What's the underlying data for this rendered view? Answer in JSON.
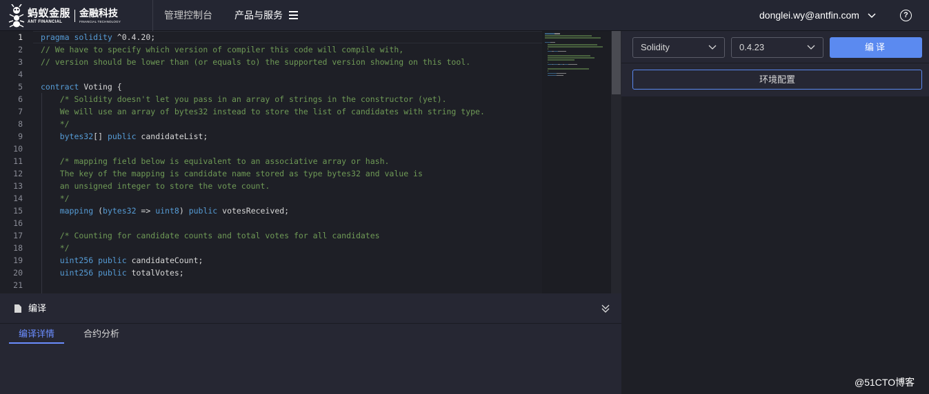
{
  "brand": {
    "name_cn": "蚂蚁金服",
    "name_en": "ANT FINANCIAL",
    "sub_cn": "金融科技",
    "sub_en": "FINANCIAL TECHNOLOGY"
  },
  "nav": {
    "console": "管理控制台",
    "products": "产品与服务",
    "user_email": "donglei.wy@antfin.com",
    "help": "?"
  },
  "editor": {
    "active_line": 1,
    "lines": [
      {
        "n": "1",
        "parts": [
          {
            "t": "pragma solidity ",
            "c": "keyword"
          },
          {
            "t": "^0.4.20;",
            "c": "plain"
          }
        ]
      },
      {
        "n": "2",
        "parts": [
          {
            "t": "// We have to specify which version of compiler this code will compile with,",
            "c": "comment"
          }
        ]
      },
      {
        "n": "3",
        "parts": [
          {
            "t": "// version should be lower than (or equals to) the supported version showing on this tool.",
            "c": "comment"
          }
        ]
      },
      {
        "n": "4",
        "parts": []
      },
      {
        "n": "5",
        "parts": [
          {
            "t": "contract ",
            "c": "keyword"
          },
          {
            "t": "Voting {",
            "c": "plain"
          }
        ]
      },
      {
        "n": "6",
        "parts": [
          {
            "t": "    /* Solidity doesn't let you pass in an array of strings in the constructor (yet).",
            "c": "comment"
          }
        ]
      },
      {
        "n": "7",
        "parts": [
          {
            "t": "    We will use an array of bytes32 instead to store the list of candidates with string type.",
            "c": "comment"
          }
        ]
      },
      {
        "n": "8",
        "parts": [
          {
            "t": "    */",
            "c": "comment"
          }
        ]
      },
      {
        "n": "9",
        "parts": [
          {
            "t": "    bytes32",
            "c": "keyword"
          },
          {
            "t": "[] ",
            "c": "plain"
          },
          {
            "t": "public ",
            "c": "keyword"
          },
          {
            "t": "candidateList;",
            "c": "plain"
          }
        ]
      },
      {
        "n": "10",
        "parts": []
      },
      {
        "n": "11",
        "parts": [
          {
            "t": "    /* mapping field below is equivalent to an associative array or hash.",
            "c": "comment"
          }
        ]
      },
      {
        "n": "12",
        "parts": [
          {
            "t": "    The key of the mapping is candidate name stored as type bytes32 and value is",
            "c": "comment"
          }
        ]
      },
      {
        "n": "13",
        "parts": [
          {
            "t": "    an unsigned integer to store the vote count.",
            "c": "comment"
          }
        ]
      },
      {
        "n": "14",
        "parts": [
          {
            "t": "    */",
            "c": "comment"
          }
        ]
      },
      {
        "n": "15",
        "parts": [
          {
            "t": "    mapping ",
            "c": "keyword"
          },
          {
            "t": "(",
            "c": "plain"
          },
          {
            "t": "bytes32 ",
            "c": "keyword"
          },
          {
            "t": "=> ",
            "c": "plain"
          },
          {
            "t": "uint8",
            "c": "keyword"
          },
          {
            "t": ") ",
            "c": "plain"
          },
          {
            "t": "public ",
            "c": "keyword"
          },
          {
            "t": "votesReceived;",
            "c": "plain"
          }
        ]
      },
      {
        "n": "16",
        "parts": []
      },
      {
        "n": "17",
        "parts": [
          {
            "t": "    /* Counting for candidate counts and total votes for all candidates",
            "c": "comment"
          }
        ]
      },
      {
        "n": "18",
        "parts": [
          {
            "t": "    */",
            "c": "comment"
          }
        ]
      },
      {
        "n": "19",
        "parts": [
          {
            "t": "    uint256 ",
            "c": "keyword"
          },
          {
            "t": "public ",
            "c": "keyword"
          },
          {
            "t": "candidateCount;",
            "c": "plain"
          }
        ]
      },
      {
        "n": "20",
        "parts": [
          {
            "t": "    uint256 ",
            "c": "keyword"
          },
          {
            "t": "public ",
            "c": "keyword"
          },
          {
            "t": "totalVotes;",
            "c": "plain"
          }
        ]
      },
      {
        "n": "21",
        "parts": []
      }
    ]
  },
  "compile_panel": {
    "title": "编译",
    "tabs": [
      {
        "label": "编译详情",
        "active": true
      },
      {
        "label": "合约分析",
        "active": false
      }
    ]
  },
  "right_panel": {
    "language_select": "Solidity",
    "version_select": "0.4.23",
    "compile_button": "编译",
    "env_button": "环境配置"
  },
  "watermark": "@51CTO博客",
  "colors": {
    "accent": "#5b8af0",
    "tab_active": "#6b8dff",
    "keyword": "#569cd6",
    "comment": "#6f9a56"
  }
}
